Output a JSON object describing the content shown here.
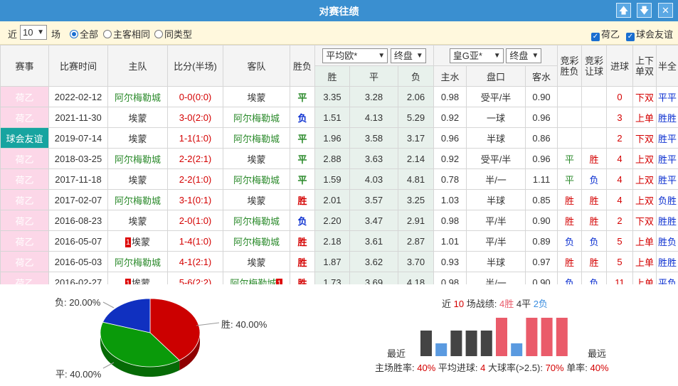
{
  "title": "对赛往绩",
  "window_buttons": {
    "up": "🡅",
    "down": "🡇",
    "close": "✕"
  },
  "filter": {
    "near_label": "近",
    "count": "10",
    "unit": "场",
    "radios": [
      {
        "label": "全部",
        "checked": true
      },
      {
        "label": "主客相同",
        "checked": false
      },
      {
        "label": "同类型",
        "checked": false
      }
    ],
    "checkboxes": [
      {
        "label": "荷乙",
        "checked": true
      },
      {
        "label": "球会友谊",
        "checked": true
      }
    ]
  },
  "headers": {
    "event": "赛事",
    "time": "比赛时间",
    "home": "主队",
    "score": "比分(半场)",
    "away": "客队",
    "result": "胜负",
    "euro_select": "平均欧*",
    "euro_phase": "终盘",
    "euro_cols": [
      "胜",
      "平",
      "负"
    ],
    "asia_select": "皇G亚*",
    "asia_phase": "终盘",
    "asia_cols": [
      "主水",
      "盘口",
      "客水"
    ],
    "jc_result": "竞彩胜负",
    "jc_handicap": "竞彩让球",
    "goals": "进球",
    "ou": "上下单双",
    "half": "半全"
  },
  "rows": [
    {
      "event": "荷乙",
      "friendly": false,
      "date": "2022-02-12",
      "home": "阿尔梅勒城",
      "home_color": "green",
      "home_card": "",
      "score": "0-0(0:0)",
      "away": "埃蒙",
      "away_color": "black",
      "away_card": "",
      "result": "平",
      "w": "3.35",
      "d": "3.28",
      "l": "2.06",
      "hw": "0.98",
      "line": "受平/半",
      "aw": "0.90",
      "jc1": "",
      "jc2": "",
      "goals": "0",
      "ou": "下双",
      "ht": "平平"
    },
    {
      "event": "荷乙",
      "friendly": false,
      "date": "2021-11-30",
      "home": "埃蒙",
      "home_color": "black",
      "home_card": "",
      "score": "3-0(2:0)",
      "away": "阿尔梅勒城",
      "away_color": "green",
      "away_card": "",
      "result": "负",
      "w": "1.51",
      "d": "4.13",
      "l": "5.29",
      "hw": "0.92",
      "line": "一球",
      "aw": "0.96",
      "jc1": "",
      "jc2": "",
      "goals": "3",
      "ou": "上单",
      "ht": "胜胜"
    },
    {
      "event": "球会友谊",
      "friendly": true,
      "date": "2019-07-14",
      "home": "埃蒙",
      "home_color": "black",
      "home_card": "",
      "score": "1-1(1:0)",
      "away": "阿尔梅勒城",
      "away_color": "green",
      "away_card": "",
      "result": "平",
      "w": "1.96",
      "d": "3.58",
      "l": "3.17",
      "hw": "0.96",
      "line": "半球",
      "aw": "0.86",
      "jc1": "",
      "jc2": "",
      "goals": "2",
      "ou": "下双",
      "ht": "胜平"
    },
    {
      "event": "荷乙",
      "friendly": false,
      "date": "2018-03-25",
      "home": "阿尔梅勒城",
      "home_color": "green",
      "home_card": "",
      "score": "2-2(2:1)",
      "away": "埃蒙",
      "away_color": "black",
      "away_card": "",
      "result": "平",
      "w": "2.88",
      "d": "3.63",
      "l": "2.14",
      "hw": "0.92",
      "line": "受平/半",
      "aw": "0.96",
      "jc1": "平",
      "jc2": "胜",
      "goals": "4",
      "ou": "上双",
      "ht": "胜平"
    },
    {
      "event": "荷乙",
      "friendly": false,
      "date": "2017-11-18",
      "home": "埃蒙",
      "home_color": "black",
      "home_card": "",
      "score": "2-2(1:0)",
      "away": "阿尔梅勒城",
      "away_color": "green",
      "away_card": "",
      "result": "平",
      "w": "1.59",
      "d": "4.03",
      "l": "4.81",
      "hw": "0.78",
      "line": "半/一",
      "aw": "1.11",
      "jc1": "平",
      "jc2": "负",
      "goals": "4",
      "ou": "上双",
      "ht": "胜平"
    },
    {
      "event": "荷乙",
      "friendly": false,
      "date": "2017-02-07",
      "home": "阿尔梅勒城",
      "home_color": "green",
      "home_card": "",
      "score": "3-1(0:1)",
      "away": "埃蒙",
      "away_color": "black",
      "away_card": "",
      "result": "胜",
      "w": "2.01",
      "d": "3.57",
      "l": "3.25",
      "hw": "1.03",
      "line": "半球",
      "aw": "0.85",
      "jc1": "胜",
      "jc2": "胜",
      "goals": "4",
      "ou": "上双",
      "ht": "负胜"
    },
    {
      "event": "荷乙",
      "friendly": false,
      "date": "2016-08-23",
      "home": "埃蒙",
      "home_color": "black",
      "home_card": "",
      "score": "2-0(1:0)",
      "away": "阿尔梅勒城",
      "away_color": "green",
      "away_card": "",
      "result": "负",
      "w": "2.20",
      "d": "3.47",
      "l": "2.91",
      "hw": "0.98",
      "line": "平/半",
      "aw": "0.90",
      "jc1": "胜",
      "jc2": "胜",
      "goals": "2",
      "ou": "下双",
      "ht": "胜胜"
    },
    {
      "event": "荷乙",
      "friendly": false,
      "date": "2016-05-07",
      "home": "埃蒙",
      "home_color": "black",
      "home_card": "1",
      "score": "1-4(1:0)",
      "away": "阿尔梅勒城",
      "away_color": "green",
      "away_card": "",
      "result": "胜",
      "w": "2.18",
      "d": "3.61",
      "l": "2.87",
      "hw": "1.01",
      "line": "平/半",
      "aw": "0.89",
      "jc1": "负",
      "jc2": "负",
      "goals": "5",
      "ou": "上单",
      "ht": "胜负"
    },
    {
      "event": "荷乙",
      "friendly": false,
      "date": "2016-05-03",
      "home": "阿尔梅勒城",
      "home_color": "green",
      "home_card": "",
      "score": "4-1(2:1)",
      "away": "埃蒙",
      "away_color": "black",
      "away_card": "",
      "result": "胜",
      "w": "1.87",
      "d": "3.62",
      "l": "3.70",
      "hw": "0.93",
      "line": "半球",
      "aw": "0.97",
      "jc1": "胜",
      "jc2": "胜",
      "goals": "5",
      "ou": "上单",
      "ht": "胜胜"
    },
    {
      "event": "荷乙",
      "friendly": false,
      "date": "2016-02-27",
      "home": "埃蒙",
      "home_color": "black",
      "home_card": "1",
      "score": "5-6(2:2)",
      "away": "阿尔梅勒城",
      "away_color": "green",
      "away_card": "1",
      "result": "胜",
      "w": "1.73",
      "d": "3.69",
      "l": "4.18",
      "hw": "0.98",
      "line": "半/一",
      "aw": "0.90",
      "jc1": "负",
      "jc2": "负",
      "goals": "11",
      "ou": "上单",
      "ht": "平负"
    }
  ],
  "pie": {
    "labels": {
      "lose": "负: 20.00%",
      "win": "胜: 40.00%",
      "draw": "平: 40.00%"
    },
    "colors": {
      "win": "#cc0000",
      "draw": "#0a9a0a",
      "lose": "#1030c0"
    }
  },
  "summary": {
    "prefix": "近",
    "count": "10",
    "mid": "场战绩:",
    "wins": "4胜",
    "draws": "4平",
    "losses": "2负",
    "recent": "最近",
    "oldest": "最远",
    "home_win_label": "主场胜率:",
    "home_win": "40%",
    "avg_goals_label": "平均进球:",
    "avg_goals": "4",
    "big_label": "大球率(>2.5):",
    "big": "70%",
    "odd_label": "单率:",
    "odd": "40%"
  },
  "chart_data": {
    "type": "bar",
    "categories": [
      "1",
      "2",
      "3",
      "4",
      "5",
      "6",
      "7",
      "8",
      "9",
      "10"
    ],
    "results": [
      "draw",
      "loss",
      "draw",
      "draw",
      "draw",
      "win",
      "loss",
      "win",
      "win",
      "win"
    ],
    "values": [
      1,
      0.5,
      1,
      1,
      1,
      1.5,
      0.5,
      1.5,
      1.5,
      1.5
    ],
    "colors": {
      "win": "#ea5b6a",
      "draw": "#444444",
      "loss": "#5a9ae0"
    }
  }
}
